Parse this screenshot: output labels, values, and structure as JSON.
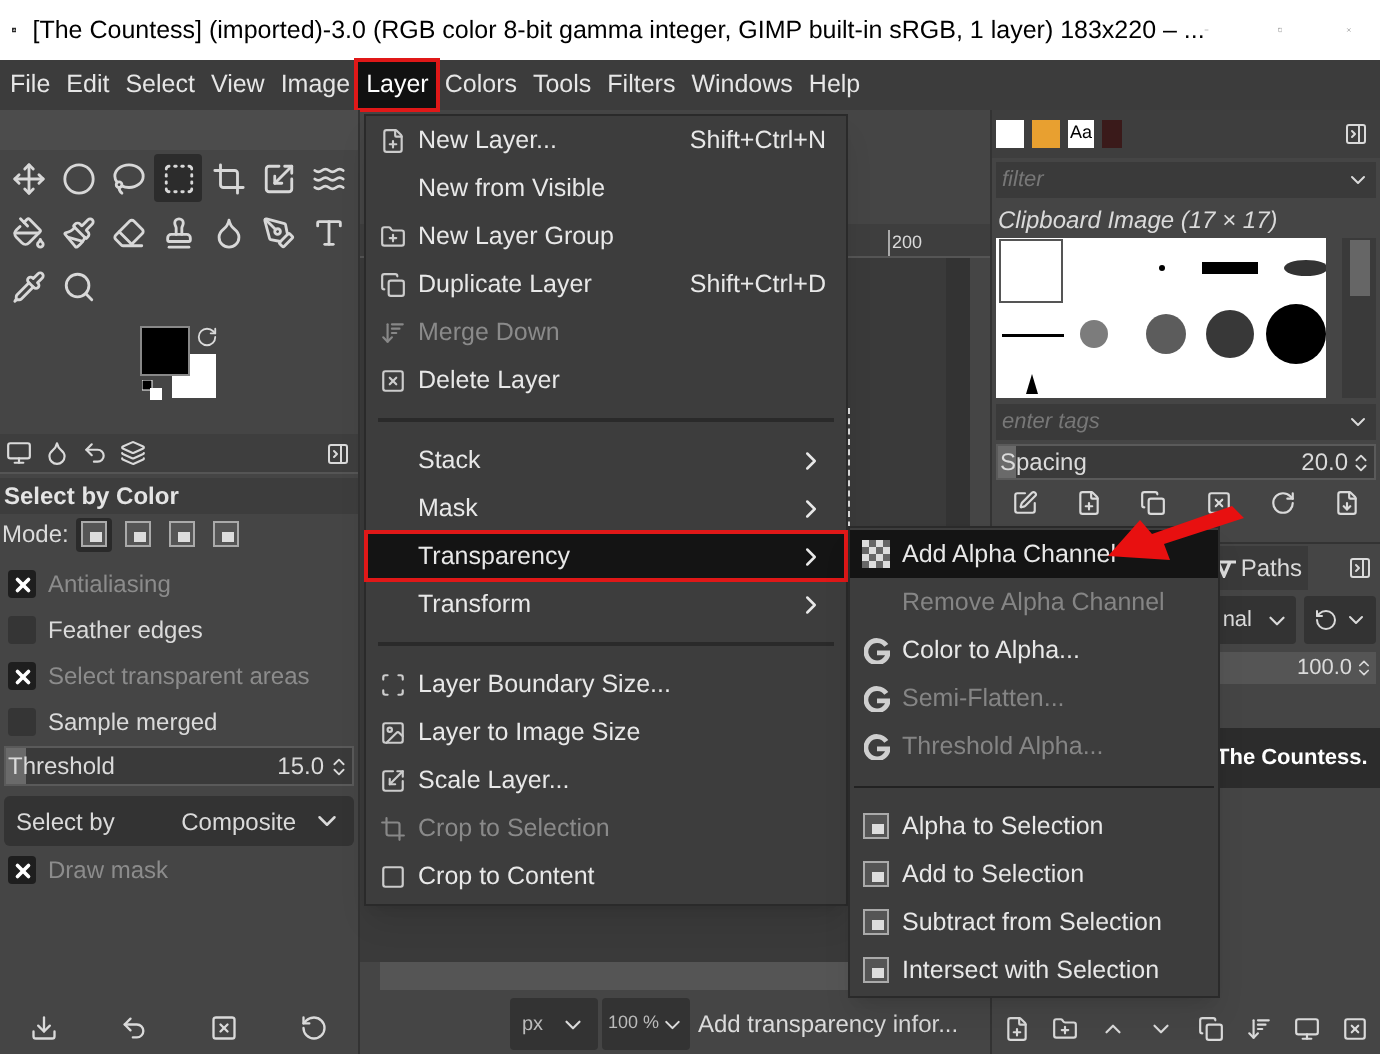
{
  "window": {
    "title": "[The Countess] (imported)-3.0 (RGB color 8-bit gamma integer, GIMP built-in sRGB, 1 layer) 183x220 – ..."
  },
  "menubar": [
    {
      "label": "File",
      "selected": false
    },
    {
      "label": "Edit",
      "selected": false
    },
    {
      "label": "Select",
      "selected": false
    },
    {
      "label": "View",
      "selected": false
    },
    {
      "label": "Image",
      "selected": false
    },
    {
      "label": "Layer",
      "selected": true
    },
    {
      "label": "Colors",
      "selected": false
    },
    {
      "label": "Tools",
      "selected": false
    },
    {
      "label": "Filters",
      "selected": false
    },
    {
      "label": "Windows",
      "selected": false
    },
    {
      "label": "Help",
      "selected": false
    }
  ],
  "toolbox": {
    "tools": [
      {
        "selected": false
      },
      {
        "selected": false
      },
      {
        "selected": false
      },
      {
        "selected": true
      },
      {
        "selected": false
      },
      {
        "selected": false
      },
      {
        "selected": false
      },
      {
        "selected": false
      },
      {
        "selected": false
      },
      {
        "selected": false
      },
      {
        "selected": false
      },
      {
        "selected": false
      },
      {
        "selected": false
      },
      {
        "selected": false
      },
      {
        "selected": false
      },
      {
        "selected": false
      }
    ]
  },
  "tool_options": {
    "title": "Select by Color",
    "mode_label": "Mode:",
    "modes": [
      {
        "selected": true
      },
      {
        "selected": false
      },
      {
        "selected": false
      },
      {
        "selected": false
      }
    ],
    "options": [
      {
        "kind": "checkbox",
        "label": "Antialiasing",
        "checked": true,
        "disabled": true
      },
      {
        "kind": "checkbox",
        "label": "Feather edges",
        "checked": false,
        "disabled": false
      },
      {
        "kind": "checkbox",
        "label": "Select transparent areas",
        "checked": true,
        "disabled": true
      },
      {
        "kind": "checkbox",
        "label": "Sample merged",
        "checked": false,
        "disabled": false
      },
      {
        "kind": "slider",
        "label": "Threshold",
        "value": "15.0",
        "level": 0.06
      },
      {
        "kind": "dropdown",
        "label": "Select by",
        "value": "Composite"
      },
      {
        "kind": "checkbox",
        "label": "Draw mask",
        "checked": true,
        "disabled": true
      }
    ]
  },
  "layer_menu": {
    "sections": [
      {
        "items": [
          {
            "label": "New Layer...",
            "shortcut": "Shift+Ctrl+N",
            "disabled": false,
            "submenu": false,
            "selected": false
          },
          {
            "label": "New from Visible",
            "disabled": false,
            "submenu": false,
            "selected": false
          },
          {
            "label": "New Layer Group",
            "disabled": false,
            "submenu": false,
            "selected": false
          },
          {
            "label": "Duplicate Layer",
            "shortcut": "Shift+Ctrl+D",
            "disabled": false,
            "submenu": false,
            "selected": false
          },
          {
            "label": "Merge Down",
            "disabled": true,
            "submenu": false,
            "selected": false
          },
          {
            "label": "Delete Layer",
            "disabled": false,
            "submenu": false,
            "selected": false
          }
        ]
      },
      {
        "items": [
          {
            "label": "Stack",
            "disabled": false,
            "submenu": true,
            "selected": false
          },
          {
            "label": "Mask",
            "disabled": false,
            "submenu": true,
            "selected": false
          },
          {
            "label": "Transparency",
            "disabled": false,
            "submenu": true,
            "selected": true
          },
          {
            "label": "Transform",
            "disabled": false,
            "submenu": true,
            "selected": false
          }
        ]
      },
      {
        "items": [
          {
            "label": "Layer Boundary Size...",
            "disabled": false,
            "submenu": false,
            "selected": false
          },
          {
            "label": "Layer to Image Size",
            "disabled": false,
            "submenu": false,
            "selected": false
          },
          {
            "label": "Scale Layer...",
            "disabled": false,
            "submenu": false,
            "selected": false
          },
          {
            "label": "Crop to Selection",
            "disabled": true,
            "submenu": false,
            "selected": false
          },
          {
            "label": "Crop to Content",
            "disabled": false,
            "submenu": false,
            "selected": false
          }
        ]
      }
    ]
  },
  "transparency_submenu": {
    "sections": [
      {
        "items": [
          {
            "label": "Add Alpha Channel",
            "disabled": false,
            "selected": true
          },
          {
            "label": "Remove Alpha Channel",
            "disabled": true,
            "selected": false
          },
          {
            "label": "Color to Alpha...",
            "disabled": false,
            "selected": false
          },
          {
            "label": "Semi-Flatten...",
            "disabled": true,
            "selected": false
          },
          {
            "label": "Threshold Alpha...",
            "disabled": true,
            "selected": false
          }
        ]
      },
      {
        "items": [
          {
            "label": "Alpha to Selection",
            "disabled": false,
            "selected": false
          },
          {
            "label": "Add to Selection",
            "disabled": false,
            "selected": false
          },
          {
            "label": "Subtract from Selection",
            "disabled": false,
            "selected": false
          },
          {
            "label": "Intersect with Selection",
            "disabled": false,
            "selected": false
          }
        ]
      }
    ]
  },
  "canvas": {
    "ruler_label": "200"
  },
  "status_bar": {
    "unit": "px",
    "zoom": "100 %",
    "message": "Add transparency infor..."
  },
  "brushes": {
    "fonts_tab": "Aa",
    "filter_placeholder": "filter",
    "brush_name": "Clipboard Image (17 × 17)",
    "tags_placeholder": "enter tags",
    "spacing": {
      "label": "Spacing",
      "value": "20.0",
      "level": 0.05
    }
  },
  "layers": {
    "tab": "Paths",
    "mode": "nal",
    "opacity": {
      "value": "100.0",
      "level": 1
    },
    "layer_name": "The Countess."
  }
}
